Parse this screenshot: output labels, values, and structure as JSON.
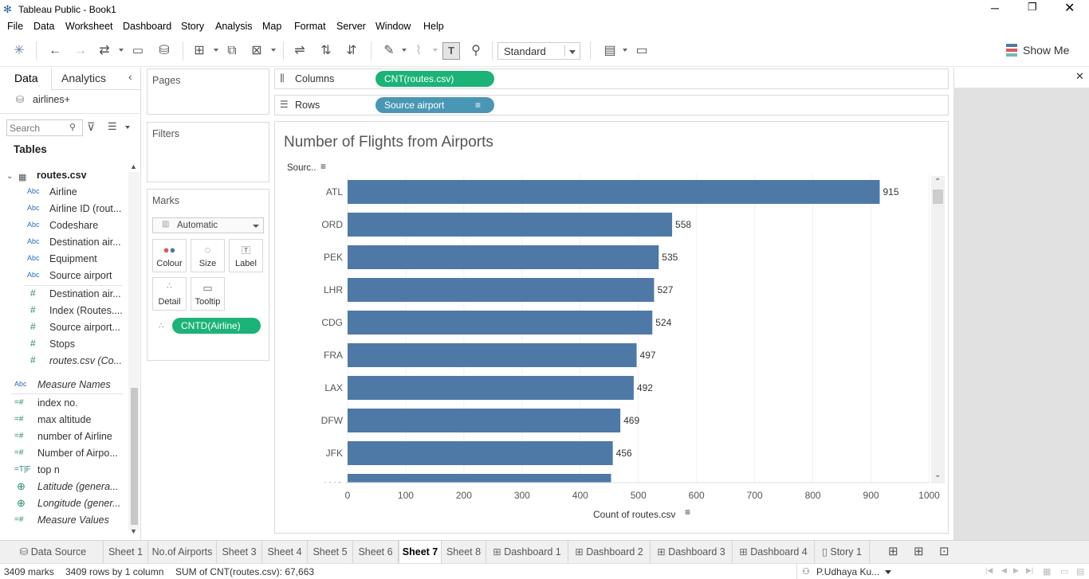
{
  "window": {
    "title": "Tableau Public - Book1"
  },
  "menu": [
    "File",
    "Data",
    "Worksheet",
    "Dashboard",
    "Story",
    "Analysis",
    "Map",
    "Format",
    "Server",
    "Window",
    "Help"
  ],
  "toolbar": {
    "mark_type": "Standard",
    "show_me": "Show Me"
  },
  "data_pane": {
    "tab_data": "Data",
    "tab_analytics": "Analytics",
    "datasource": "airlines+",
    "search_placeholder": "Search",
    "tables_heading": "Tables",
    "table_name": "routes.csv",
    "dimensions": [
      {
        "type": "Abc",
        "label": "Airline"
      },
      {
        "type": "Abc",
        "label": "Airline ID (rout..."
      },
      {
        "type": "Abc",
        "label": "Codeshare"
      },
      {
        "type": "Abc",
        "label": "Destination air..."
      },
      {
        "type": "Abc",
        "label": "Equipment"
      },
      {
        "type": "Abc",
        "label": "Source airport"
      },
      {
        "type": "#",
        "label": "Destination air..."
      },
      {
        "type": "#",
        "label": "Index (Routes...."
      },
      {
        "type": "#",
        "label": "Source airport..."
      },
      {
        "type": "#",
        "label": "Stops"
      },
      {
        "type": "#",
        "label": "routes.csv (Co..."
      }
    ],
    "measure_names": {
      "type": "Abc",
      "label": "Measure Names"
    },
    "measures": [
      {
        "type": "=#",
        "label": "index no."
      },
      {
        "type": "=#",
        "label": "max altitude"
      },
      {
        "type": "=#",
        "label": "number of Airline"
      },
      {
        "type": "=#",
        "label": "Number of Airpo..."
      },
      {
        "type": "=T|F",
        "label": "top n"
      },
      {
        "type": "globe",
        "label": "Latitude (genera..."
      },
      {
        "type": "globe",
        "label": "Longitude (gener..."
      },
      {
        "type": "=#",
        "label": "Measure Values"
      }
    ]
  },
  "cards": {
    "pages": "Pages",
    "filters": "Filters",
    "marks": "Marks",
    "mark_type": "Automatic",
    "buttons": [
      "Colour",
      "Size",
      "Label",
      "Detail",
      "Tooltip"
    ],
    "mark_pill": "CNTD(Airline)"
  },
  "shelves": {
    "columns_label": "Columns",
    "columns_pill": "CNT(routes.csv)",
    "rows_label": "Rows",
    "rows_pill": "Source airport"
  },
  "colors": {
    "bar": "#4e79a7",
    "green_pill": "#1bb377",
    "blue_pill": "#4a97b5"
  },
  "chart_data": {
    "type": "bar",
    "orientation": "horizontal",
    "title": "Number of Flights from Airports",
    "row_header": "Sourc..",
    "xlabel": "Count of routes.csv",
    "xlim": [
      0,
      1000
    ],
    "xticks": [
      0,
      100,
      200,
      300,
      400,
      500,
      600,
      700,
      800,
      900,
      1000
    ],
    "categories": [
      "ATL",
      "ORD",
      "PEK",
      "LHR",
      "CDG",
      "FRA",
      "LAX",
      "DFW",
      "JFK",
      "AMS"
    ],
    "values": [
      915,
      558,
      535,
      527,
      524,
      497,
      492,
      469,
      456,
      453
    ],
    "data_labels": [
      "915",
      "558",
      "535",
      "527",
      "524",
      "497",
      "492",
      "469",
      "456",
      ""
    ],
    "grid": true
  },
  "tabs": [
    {
      "label": "Data Source",
      "icon": "database-icon"
    },
    {
      "label": "Sheet 1"
    },
    {
      "label": "No.of Airports"
    },
    {
      "label": "Sheet 3"
    },
    {
      "label": "Sheet 4"
    },
    {
      "label": "Sheet 5"
    },
    {
      "label": "Sheet 6"
    },
    {
      "label": "Sheet 7",
      "active": true
    },
    {
      "label": "Sheet 8"
    },
    {
      "label": "Dashboard 1",
      "icon": "dashboard-icon"
    },
    {
      "label": "Dashboard 2",
      "icon": "dashboard-icon"
    },
    {
      "label": "Dashboard 3",
      "icon": "dashboard-icon"
    },
    {
      "label": "Dashboard 4",
      "icon": "dashboard-icon"
    },
    {
      "label": "Story 1",
      "icon": "story-icon"
    }
  ],
  "status": {
    "marks": "3409 marks",
    "rows": "3409 rows by 1 column",
    "sum": "SUM of CNT(routes.csv): 67,663",
    "user": "P.Udhaya Ku..."
  }
}
